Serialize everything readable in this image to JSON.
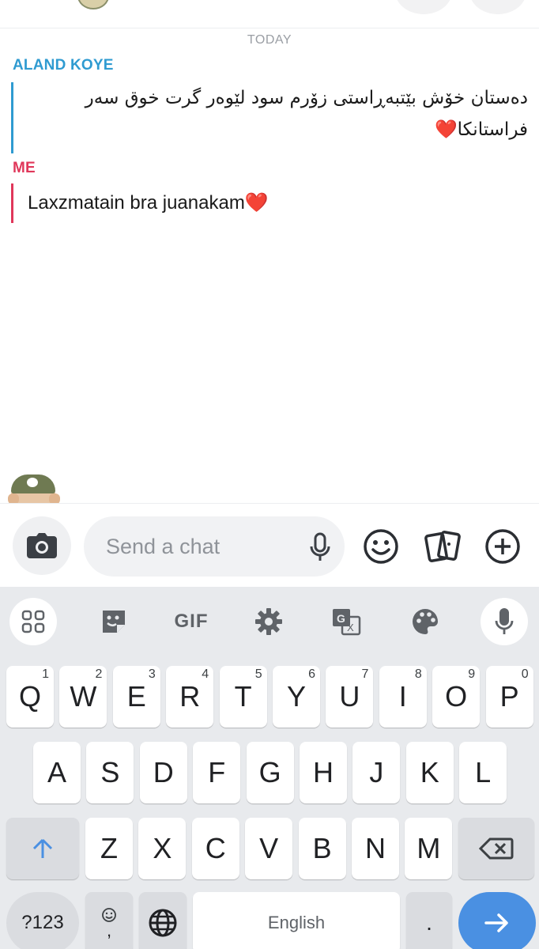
{
  "conversation": {
    "date_divider": "TODAY",
    "messages": [
      {
        "sender": "ALAND KOYE",
        "sender_color": "#2f9bd1",
        "text": "دەستان خۆش بێتبەڕاستی زۆرم سود لێوەر گرت خوق سەر فراستانکا",
        "emoji": "❤️"
      },
      {
        "sender": "ME",
        "sender_color": "#e0375a",
        "text": "Laxzmatain bra juanakam",
        "emoji": "❤️"
      }
    ]
  },
  "compose": {
    "placeholder": "Send a chat"
  },
  "keyboard": {
    "toolbar": {
      "gif_label": "GIF"
    },
    "row1": [
      {
        "letter": "Q",
        "hint": "1"
      },
      {
        "letter": "W",
        "hint": "2"
      },
      {
        "letter": "E",
        "hint": "3"
      },
      {
        "letter": "R",
        "hint": "4"
      },
      {
        "letter": "T",
        "hint": "5"
      },
      {
        "letter": "Y",
        "hint": "6"
      },
      {
        "letter": "U",
        "hint": "7"
      },
      {
        "letter": "I",
        "hint": "8"
      },
      {
        "letter": "O",
        "hint": "9"
      },
      {
        "letter": "P",
        "hint": "0"
      }
    ],
    "row2": [
      "A",
      "S",
      "D",
      "F",
      "G",
      "H",
      "J",
      "K",
      "L"
    ],
    "row3": [
      "Z",
      "X",
      "C",
      "V",
      "B",
      "N",
      "M"
    ],
    "symbols_label": "?123",
    "comma_label": ",",
    "space_label": "English",
    "period_label": "."
  },
  "colors": {
    "accent_blue": "#2f9bd1",
    "accent_red": "#e0375a",
    "enter_key": "#4a90e2"
  }
}
